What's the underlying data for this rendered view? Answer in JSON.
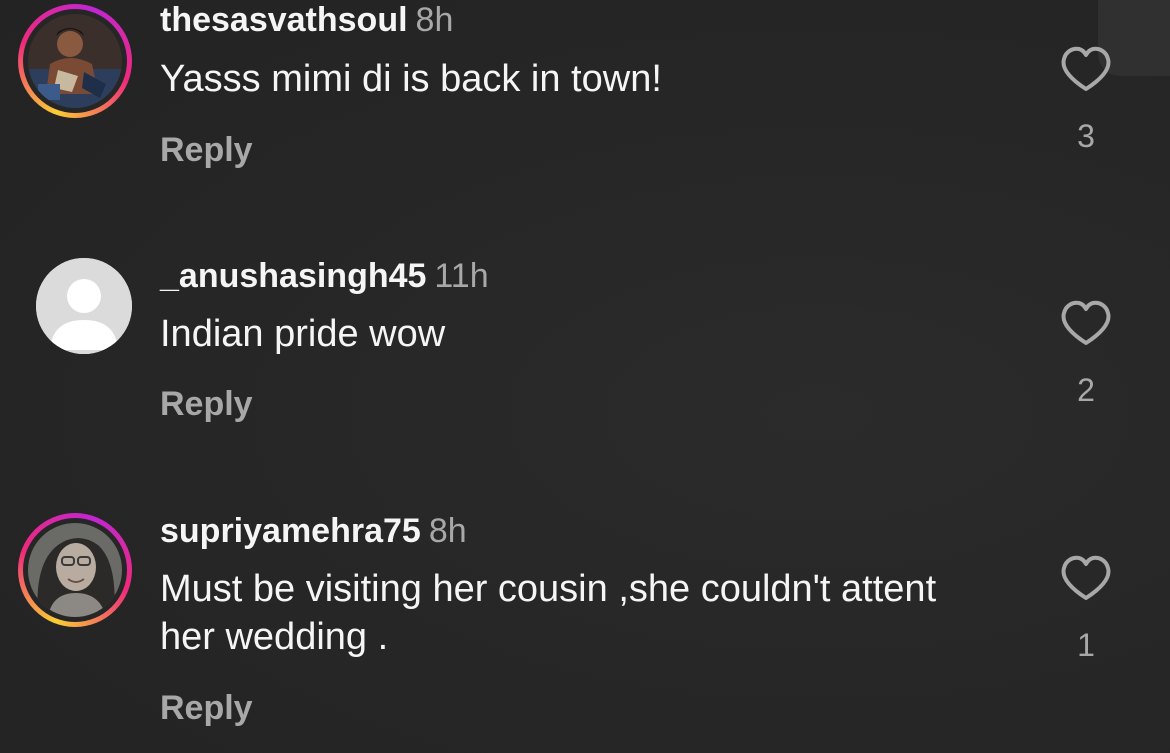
{
  "comments": [
    {
      "username": "thesasvathsoul",
      "time": "8h",
      "text": "Yasss mimi di is back in town!",
      "reply_label": "Reply",
      "likes": "3",
      "avatar": "photo-avatar-story-ring"
    },
    {
      "username": "_anushasingh45",
      "time": "11h",
      "text": "Indian pride wow",
      "reply_label": "Reply",
      "likes": "2",
      "avatar": "default-avatar"
    },
    {
      "username": "supriyamehra75",
      "time": "8h",
      "text": "Must be visiting her cousin ,she couldn't attent her wedding .",
      "reply_label": "Reply",
      "likes": "1",
      "avatar": "photo-avatar-story-ring"
    }
  ],
  "colors": {
    "background": "#262626",
    "primary_text": "#f5f5f5",
    "secondary_text": "#a8a8a8",
    "story_ring_start": "#f9ce34",
    "story_ring_end": "#c026d3"
  },
  "icons": {
    "like": "heart-outline-icon"
  }
}
